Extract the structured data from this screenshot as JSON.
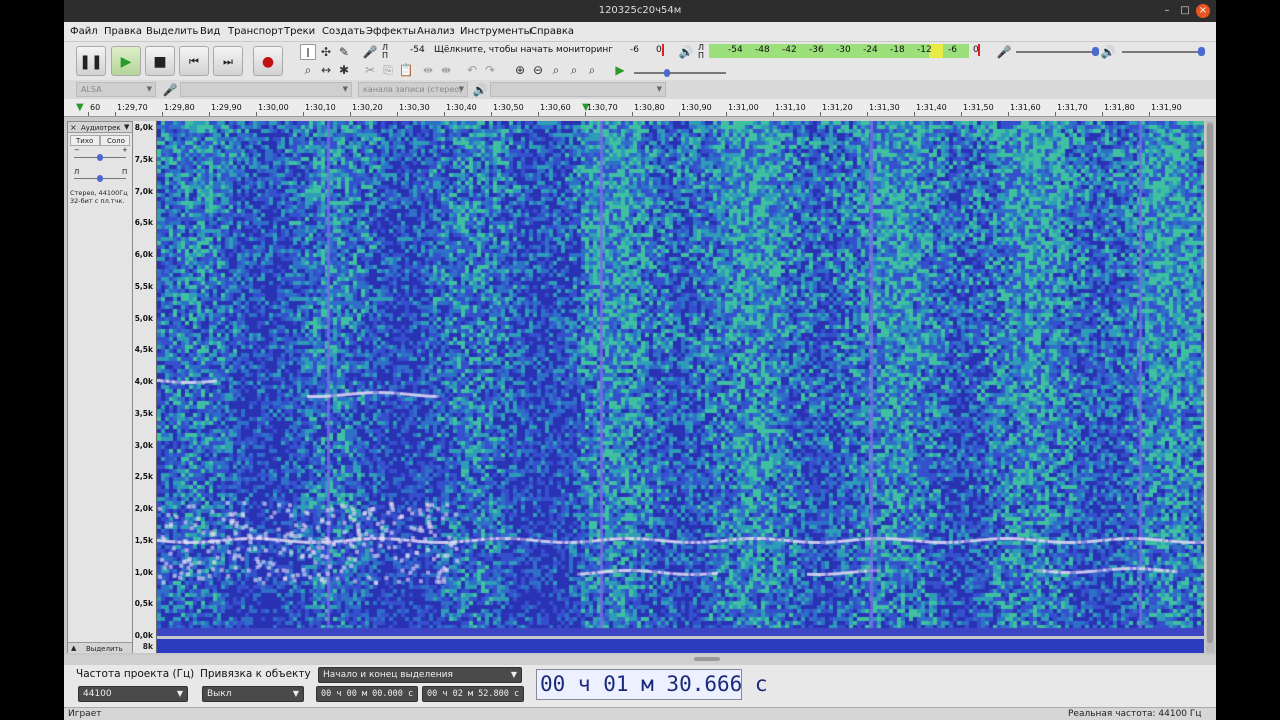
{
  "window": {
    "title": "120325с20ч54м"
  },
  "menu": [
    "Файл",
    "Правка",
    "Выделить",
    "Вид",
    "Транспорт",
    "Треки",
    "Создать",
    "Эффекты",
    "Анализ",
    "Инструменты",
    "Справка"
  ],
  "rec_meter": {
    "lr_left": "Л",
    "lr_right": "П",
    "ticks": [
      "-54",
      "-6",
      "0"
    ],
    "prompt": "Щёлкните, чтобы начать мониторинг"
  },
  "play_meter": {
    "lr_left": "Л",
    "lr_right": "П",
    "ticks": [
      "-54",
      "-48",
      "-42",
      "-36",
      "-30",
      "-24",
      "-18",
      "-12",
      "-6",
      "0"
    ]
  },
  "device": {
    "host": "ALSA",
    "channels": "канала записи (стерео)"
  },
  "ruler": [
    "60",
    "1:29,70",
    "1:29,80",
    "1:29,90",
    "1:30,00",
    "1:30,10",
    "1:30,20",
    "1:30,30",
    "1:30,40",
    "1:30,50",
    "1:30,60",
    "1:30,70",
    "1:30,80",
    "1:30,90",
    "1:31,00",
    "1:31,10",
    "1:31,20",
    "1:31,30",
    "1:31,40",
    "1:31,50",
    "1:31,60",
    "1:31,70",
    "1:31,80",
    "1:31,90"
  ],
  "track": {
    "name": "Аудиотрек",
    "mute": "Тихо",
    "solo": "Соло",
    "gain_minus": "−",
    "gain_plus": "+",
    "pan_left": "Л",
    "pan_right": "П",
    "info1": "Стерео, 44100Гц",
    "info2": "32-бит с пл.тчк.",
    "select": "Выделить"
  },
  "freq_scale": [
    "8,0k",
    "7,5k",
    "7,0k",
    "6,5k",
    "6,0k",
    "5,5k",
    "5,0k",
    "4,5k",
    "4,0k",
    "3,5k",
    "3,0k",
    "2,5k",
    "2,0k",
    "1,5k",
    "1,0k",
    "0,5k",
    "0,0k"
  ],
  "freq_scale2": "8k",
  "selection": {
    "rate_label": "Частота проекта (Гц)",
    "rate": "44100",
    "snap_label": "Привязка к объекту",
    "snap": "Выкл",
    "mode": "Начало и конец выделения",
    "start": "00 ч 00 м 00.000 с",
    "end": "00 ч 02 м 52.800 с"
  },
  "time_display": "00 ч 01 м 30.666 с",
  "status": {
    "left": "Играет",
    "right": "Реальная частота: 44100 Гц"
  }
}
